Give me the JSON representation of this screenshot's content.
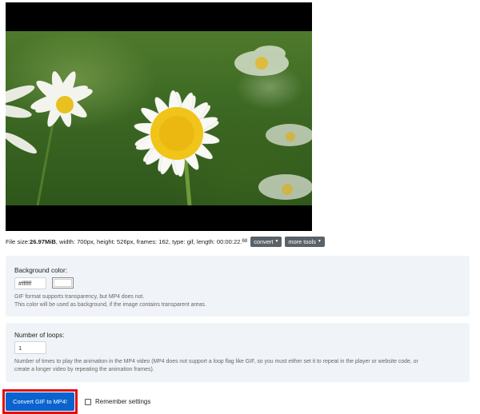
{
  "preview": {
    "alt": "daisy flower animation preview"
  },
  "file_info": {
    "size_label": "File size: ",
    "size_value": "26.97MiB",
    "rest": ", width: 700px, height: 526px, frames: 162, type: gif, length: 00:00:22.",
    "length_fraction": "68",
    "convert_menu": "convert",
    "tools_menu": "more tools"
  },
  "background": {
    "heading": "Background color:",
    "value": "#ffffff",
    "help_line1": "GIF format supports transparency, but MP4 does not.",
    "help_line2": "This color will be used as background, if the image contains transparent areas."
  },
  "loops": {
    "heading": "Number of loops:",
    "value": "1",
    "help_line1": "Number of times to play the animation in the MP4 video (MP4 does not support a loop flag like GIF, so you must either set it to repeat in the player or website code, or",
    "help_line2": "create a longer video by repeating the animation frames)."
  },
  "actions": {
    "convert_label": "Convert GIF to MP4!",
    "remember_label": "Remember settings"
  },
  "colors": {
    "primary": "#0a63cf",
    "highlight": "#e01010",
    "panel": "#f0f4f8"
  }
}
